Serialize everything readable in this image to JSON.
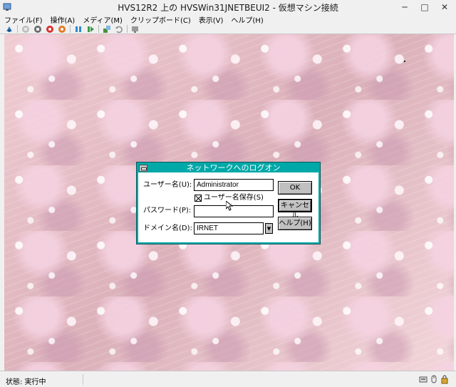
{
  "window": {
    "title": "HVS12R2 上の HVSWin31JNETBEUI2 - 仮想マシン接続",
    "minimize": "─",
    "maximize": "□",
    "close": "✕"
  },
  "menu": [
    {
      "label": "ファイル(F)"
    },
    {
      "label": "操作(A)"
    },
    {
      "label": "メディア(M)"
    },
    {
      "label": "クリップボード(C)"
    },
    {
      "label": "表示(V)"
    },
    {
      "label": "ヘルプ(H)"
    }
  ],
  "toolbar_icons": [
    "ctrl-alt-del-icon",
    "start-icon",
    "turn-off-icon",
    "shut-down-icon",
    "save-icon",
    "pause-icon",
    "reset-icon",
    "checkpoint-icon",
    "revert-icon",
    "enhanced-session-icon"
  ],
  "dialog": {
    "title": "ネットワークへのログオン",
    "username_label": "ユーザー名(U):",
    "username_value": "Administrator",
    "save_username_label": "ユーザー名保存(S)",
    "save_username_checked": true,
    "password_label": "パスワード(P):",
    "password_value": "",
    "domain_label": "ドメイン名(D):",
    "domain_value": "IRNET",
    "ok_label": "OK",
    "cancel_label": "キャンセル",
    "help_label": "ヘルプ(H)"
  },
  "status": {
    "text": "状態: 実行中"
  },
  "colors": {
    "dialog_title_bg": "#00a8a8",
    "desktop_bg": "#e8c2c8"
  }
}
